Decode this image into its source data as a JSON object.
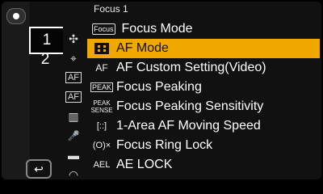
{
  "colors": {
    "accent": "#f0a800",
    "background": "#111111",
    "text": "#ffffff"
  },
  "tabs": {
    "top_icon": "custom-menu-icon",
    "items": [
      {
        "label": "1",
        "active": true
      },
      {
        "label": "2",
        "active": false
      }
    ]
  },
  "sidebar_icons": [
    {
      "name": "af-area-icon",
      "glyph": "✣"
    },
    {
      "name": "af-subject-icon",
      "glyph": "⌖"
    },
    {
      "name": "af-mode-icon",
      "glyph": "AF"
    },
    {
      "name": "af-custom-icon",
      "glyph": "AF"
    },
    {
      "name": "filmstrip-icon",
      "glyph": "▥"
    },
    {
      "name": "microphone-icon",
      "glyph": "🎤"
    },
    {
      "name": "camera-mode-icon",
      "glyph": "▬"
    },
    {
      "name": "lens-icon",
      "glyph": "◠"
    }
  ],
  "menu": {
    "title": "Focus 1",
    "items": [
      {
        "icon": "focus-mode-icon",
        "icon_text": "Focus",
        "label": "Focus Mode",
        "selected": false
      },
      {
        "icon": "af-mode-icon",
        "icon_text": "▦",
        "label": "AF Mode",
        "selected": true
      },
      {
        "icon": "af-custom-setting-icon",
        "icon_text": "AF",
        "label": "AF Custom Setting(Video)",
        "selected": false
      },
      {
        "icon": "focus-peaking-icon",
        "icon_text": "PEAK",
        "label": "Focus Peaking",
        "selected": false
      },
      {
        "icon": "peak-sensitivity-icon",
        "icon_text": "PEAK SENSE",
        "label": "Focus Peaking Sensitivity",
        "selected": false
      },
      {
        "icon": "one-area-icon",
        "icon_text": "[::]",
        "label": "1-Area AF Moving Speed",
        "selected": false
      },
      {
        "icon": "focus-ring-lock-icon",
        "icon_text": "(O)×",
        "label": "Focus Ring Lock",
        "selected": false
      },
      {
        "icon": "ae-lock-icon",
        "icon_text": "AEL",
        "label": "AE LOCK",
        "selected": false
      }
    ]
  },
  "back_button": {
    "icon": "return-icon",
    "glyph": "↩"
  }
}
